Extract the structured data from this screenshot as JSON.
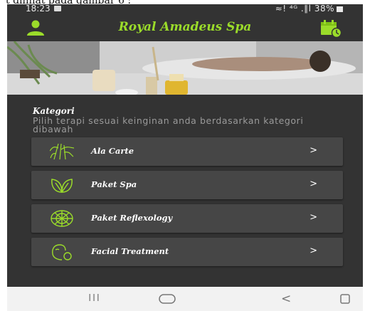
{
  "caption": "t dilihat pada gambar 6 :",
  "status_bar": {
    "time": "18:23",
    "right": "≈! ⁴ᴳ .∥l 38%"
  },
  "app_bar": {
    "title": "Royal Amadeus Spa",
    "accent_color": "#9bdc2a",
    "left_icon": "profile-icon",
    "right_icon": "booking-icon"
  },
  "section": {
    "title": "Kategori",
    "subtitle": "Pilih terapi sesuai keinginan anda berdasarkan kategori dibawah"
  },
  "categories": [
    {
      "label": "Ala Carte",
      "icon": "bamboo-icon",
      "arrow": ">"
    },
    {
      "label": "Paket Spa",
      "icon": "leaf-icon",
      "arrow": ">"
    },
    {
      "label": "Paket Reflexology",
      "icon": "reflexology-icon",
      "arrow": ">"
    },
    {
      "label": "Facial Treatment",
      "icon": "facial-icon",
      "arrow": ">"
    }
  ],
  "nav_bar": {
    "recents": "III",
    "back": "<"
  }
}
